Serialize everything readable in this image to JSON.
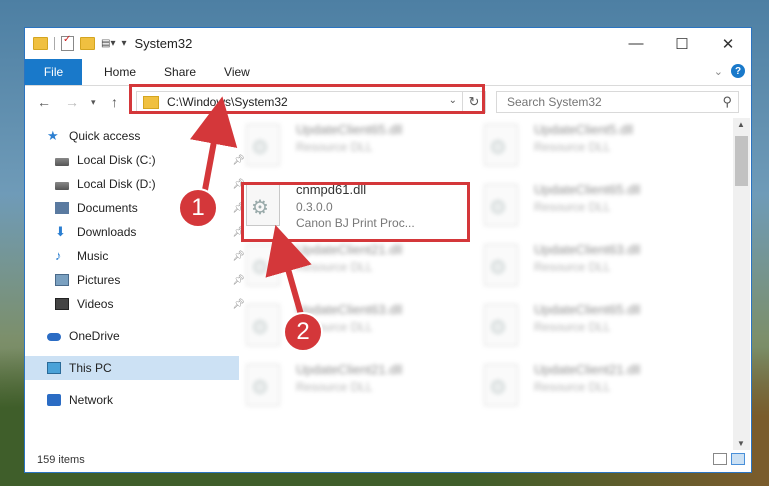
{
  "window": {
    "title": "System32",
    "controls": {
      "minimize": "—",
      "maximize": "☐",
      "close": "✕"
    }
  },
  "ribbon": {
    "file_tab": "File",
    "tabs": [
      "Home",
      "Share",
      "View"
    ]
  },
  "navigation": {
    "address_path": "C:\\Windows\\System32",
    "search_placeholder": "Search System32"
  },
  "sidebar": {
    "items": [
      {
        "label": "Quick access",
        "icon": "star-icon"
      },
      {
        "label": "Local Disk (C:)",
        "icon": "disk-icon",
        "pinned": true
      },
      {
        "label": "Local Disk (D:)",
        "icon": "disk-icon",
        "pinned": true
      },
      {
        "label": "Documents",
        "icon": "documents-icon",
        "pinned": true
      },
      {
        "label": "Downloads",
        "icon": "downloads-icon",
        "pinned": true
      },
      {
        "label": "Music",
        "icon": "music-icon",
        "pinned": true
      },
      {
        "label": "Pictures",
        "icon": "pictures-icon",
        "pinned": true
      },
      {
        "label": "Videos",
        "icon": "videos-icon",
        "pinned": true
      },
      {
        "label": "OneDrive",
        "icon": "onedrive-icon"
      },
      {
        "label": "This PC",
        "icon": "this-pc-icon",
        "selected": true
      },
      {
        "label": "Network",
        "icon": "network-icon"
      }
    ]
  },
  "files": [
    {
      "name": "UpdateClient65.dll",
      "desc": "Resource DLL"
    },
    {
      "name": "UpdateClient5.dll",
      "desc": "Resource DLL"
    },
    {
      "name": "cnmpd61.dll",
      "version": "0.3.0.0",
      "desc": "Canon BJ Print Proc..."
    },
    {
      "name": "UpdateClient65.dll",
      "desc": "Resource DLL"
    },
    {
      "name": "UpdateClient21.dll",
      "desc": "Resource DLL"
    },
    {
      "name": "UpdateClient63.dll",
      "desc": "Resource DLL"
    },
    {
      "name": "UpdateClient63.dll",
      "desc": "Resource DLL"
    },
    {
      "name": "UpdateClient65.dll",
      "desc": "Resource DLL"
    },
    {
      "name": "UpdateClient21.dll",
      "desc": "Resource DLL"
    },
    {
      "name": "UpdateClient21.dll",
      "desc": "Resource DLL"
    }
  ],
  "status": {
    "item_count": "159 items"
  },
  "annotations": {
    "callout_1": "1",
    "callout_2": "2",
    "color": "#d4373a"
  }
}
